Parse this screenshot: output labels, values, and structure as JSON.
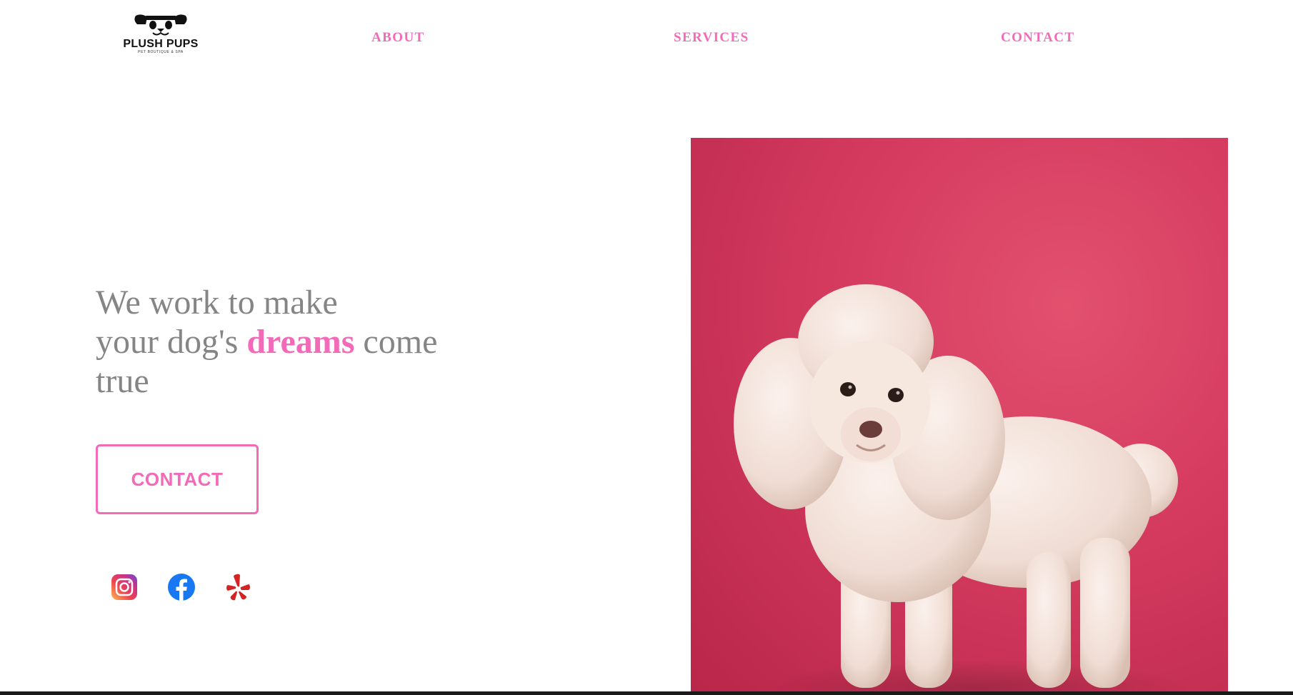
{
  "brand": {
    "name": "PLUSH PUPS",
    "tagline": "PET BOUTIQUE & SPA"
  },
  "nav": {
    "items": [
      {
        "label": "ABOUT"
      },
      {
        "label": "SERVICES"
      },
      {
        "label": "CONTACT"
      }
    ]
  },
  "hero": {
    "line1": "We work to make",
    "line2_prefix": "your dog's",
    "highlight": "dreams",
    "line2_suffix": "come",
    "line3": "true",
    "button_label": "CONTACT",
    "image_alt": "White poodle standing against a pink backdrop"
  },
  "social": [
    {
      "icon": "instagram-icon"
    },
    {
      "icon": "facebook-icon"
    },
    {
      "icon": "yelp-icon"
    }
  ],
  "colors": {
    "accent": "#f26ab8",
    "text_gray": "#858585",
    "photo_bg": "#d63c60"
  }
}
